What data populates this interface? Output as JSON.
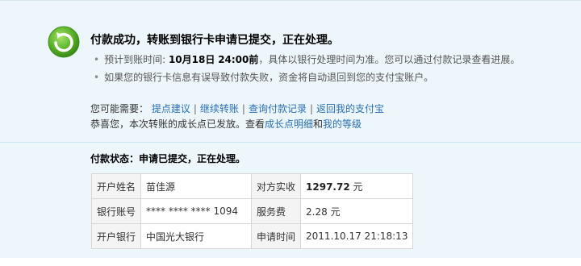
{
  "status": {
    "title": "付款成功，转账到银行卡申请已提交，正在处理。",
    "bullet1_prefix": "预计到账时间:",
    "bullet1_date": "10月18日",
    "bullet1_time": "24:00前",
    "bullet1_suffix": "，具体以银行处理时间为准。您可以通过付款记录查看进展。",
    "bullet2": "如果您的银行卡信息有误导致付款失败，资金将自动退回到您的支付宝账户。"
  },
  "needs": {
    "label": "您可能需要：",
    "links": [
      "提点建议",
      "继续转账",
      "查询付款记录",
      "返回我的支付宝"
    ],
    "separator": "|"
  },
  "growth": {
    "prefix": "恭喜您，本次转账的成长点已发放。查看",
    "link1": "成长点明细",
    "middle": "和",
    "link2": "我的等级"
  },
  "payment_status_line": "付款状态：申请已提交，正在处理。",
  "details": {
    "account_name_label": "开户姓名",
    "account_name": "苗佳源",
    "received_label": "对方实收",
    "received_amount": "1297.72",
    "currency": "元",
    "bank_no_label": "银行账号",
    "bank_no": "**** **** **** 1094",
    "fee_label": "服务费",
    "fee_amount": "2.28",
    "bank_label": "开户银行",
    "bank": "中国光大银行",
    "apply_time_label": "申请时间",
    "apply_time": "2011.10.17 21:18:13"
  },
  "colors": {
    "panel_bg": "#edf6fb",
    "link": "#2a6fb4",
    "icon_green": "#5cb32b"
  }
}
